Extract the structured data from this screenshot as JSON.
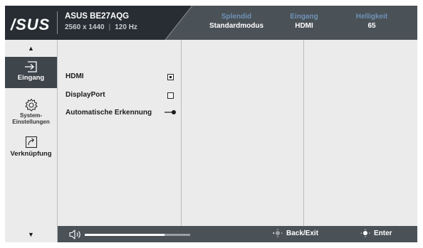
{
  "header": {
    "logo": "/SUS",
    "model": "ASUS BE27AQG",
    "resolution": "2560 x 1440",
    "refresh": "120 Hz",
    "stats": [
      {
        "label": "Splendid",
        "value": "Standardmodus"
      },
      {
        "label": "Eingang",
        "value": "HDMI"
      },
      {
        "label": "Helligkeit",
        "value": "65"
      }
    ]
  },
  "sidebar": {
    "up_glyph": "▲",
    "down_glyph": "▼",
    "items": [
      {
        "label": "Eingang",
        "icon": "input-arrow-icon",
        "active": true
      },
      {
        "label": "System-\nEinstellungen",
        "icon": "gear-icon",
        "active": false
      },
      {
        "label": "Verknüpfung",
        "icon": "shortcut-arrow-icon",
        "active": false
      }
    ]
  },
  "options": [
    {
      "label": "HDMI",
      "control": "checkbox",
      "checked": true
    },
    {
      "label": "DisplayPort",
      "control": "checkbox",
      "checked": false
    },
    {
      "label": "Automatische Erkennung",
      "control": "toggle",
      "on": true
    }
  ],
  "footer": {
    "volume_icon": "speaker-icon",
    "volume_level": 0.76,
    "back_label": "Back/Exit",
    "enter_label": "Enter"
  },
  "colors": {
    "header_bg": "#4a5157",
    "header_dark": "#272d33",
    "panel_bg": "#ebebeb",
    "accent_label": "#6f93b7",
    "active_item": "#3e454b"
  }
}
